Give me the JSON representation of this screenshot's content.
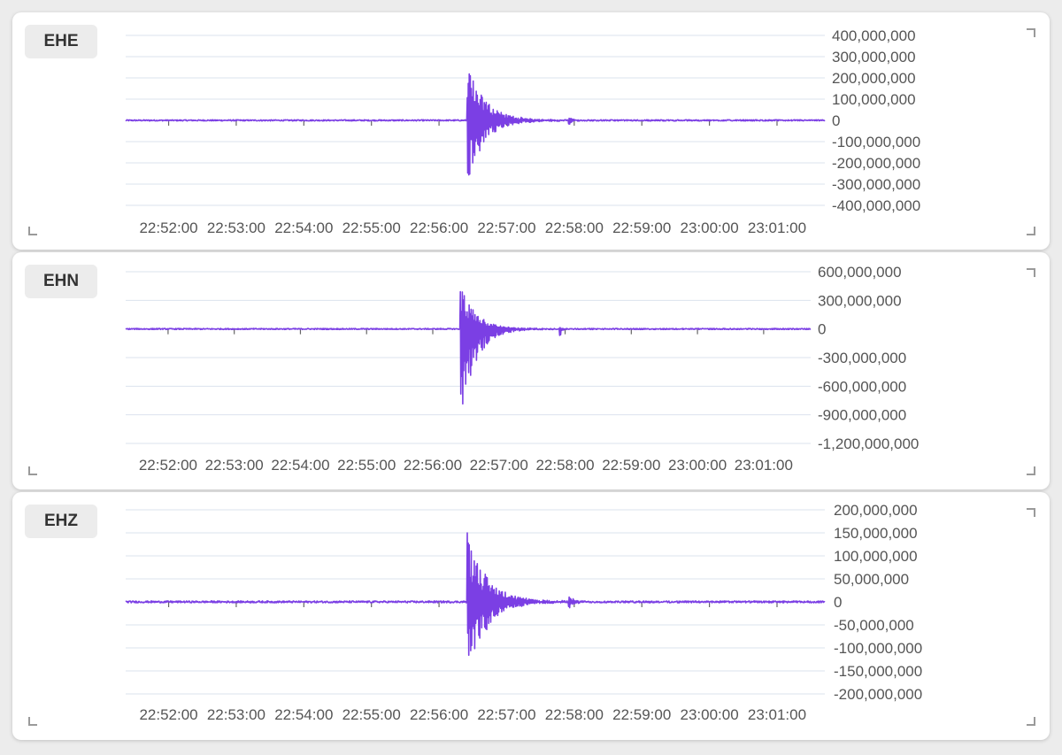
{
  "colors": {
    "trace": "#7b3fe4",
    "grid": "#dbe3ee",
    "axis": "#666666"
  },
  "chart_data": [
    {
      "type": "line",
      "channel": "EHE",
      "time_labels": [
        "22:52:00",
        "22:53:00",
        "22:54:00",
        "22:55:00",
        "22:56:00",
        "22:57:00",
        "22:58:00",
        "22:59:00",
        "23:00:00",
        "23:01:00"
      ],
      "y_ticks": [
        "400,000,000",
        "300,000,000",
        "200,000,000",
        "100,000,000",
        "0",
        "-100,000,000",
        "-200,000,000",
        "-300,000,000",
        "-400,000,000"
      ],
      "ylim": [
        -400000000,
        400000000
      ],
      "events": [
        {
          "time_min": 4.85,
          "peak_pos": 300000000,
          "peak_neg": -320000000,
          "decay_min": 0.45
        },
        {
          "time_min": 6.35,
          "peak_pos": 25000000,
          "peak_neg": -30000000,
          "decay_min": 0.08
        }
      ],
      "noise": 3000000
    },
    {
      "type": "line",
      "channel": "EHN",
      "time_labels": [
        "22:52:00",
        "22:53:00",
        "22:54:00",
        "22:55:00",
        "22:56:00",
        "22:57:00",
        "22:58:00",
        "22:59:00",
        "23:00:00",
        "23:01:00"
      ],
      "y_ticks": [
        "600,000,000",
        "300,000,000",
        "0",
        "-300,000,000",
        "-600,000,000",
        "-900,000,000",
        "-1,200,000,000"
      ],
      "ylim": [
        -1200000000,
        600000000
      ],
      "events": [
        {
          "time_min": 4.85,
          "peak_pos": 510000000,
          "peak_neg": -1050000000,
          "decay_min": 0.4
        },
        {
          "time_min": 6.35,
          "peak_pos": 20000000,
          "peak_neg": -140000000,
          "decay_min": 0.05
        }
      ],
      "noise": 6000000
    },
    {
      "type": "line",
      "channel": "EHZ",
      "time_labels": [
        "22:52:00",
        "22:53:00",
        "22:54:00",
        "22:55:00",
        "22:56:00",
        "22:57:00",
        "22:58:00",
        "22:59:00",
        "23:00:00",
        "23:01:00"
      ],
      "y_ticks": [
        "200,000,000",
        "150,000,000",
        "100,000,000",
        "50,000,000",
        "0",
        "-50,000,000",
        "-100,000,000",
        "-150,000,000",
        "-200,000,000"
      ],
      "ylim": [
        -200000000,
        200000000
      ],
      "events": [
        {
          "time_min": 4.85,
          "peak_pos": 160000000,
          "peak_neg": -170000000,
          "decay_min": 0.5
        },
        {
          "time_min": 6.35,
          "peak_pos": 20000000,
          "peak_neg": -20000000,
          "decay_min": 0.1
        }
      ],
      "noise": 2000000
    }
  ]
}
